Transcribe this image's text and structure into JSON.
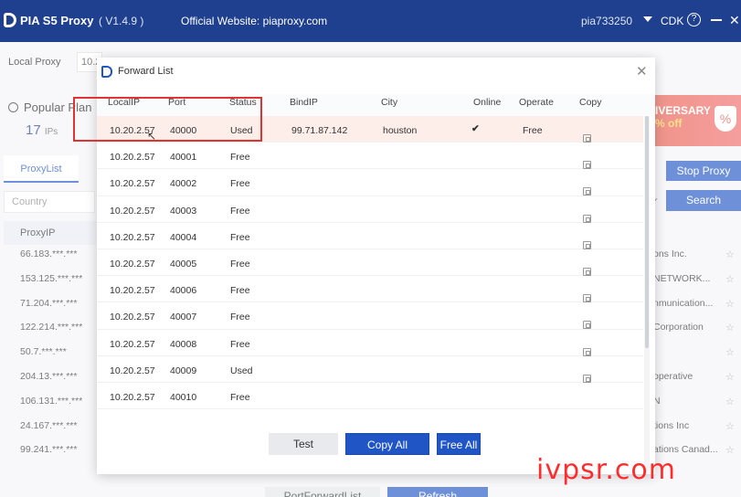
{
  "titlebar": {
    "brand": "PIA S5 Proxy",
    "version": "( V1.4.9 )",
    "website": "Official Website:  piaproxy.com",
    "user": "pia733250",
    "cdk": "CDK",
    "help": "?",
    "close": "✕"
  },
  "background": {
    "local_proxy_label": "Local Proxy",
    "local_proxy_value": "10.2",
    "popular_plan": "Popular Plan",
    "ips_count": "17",
    "ips_unit": "IPs",
    "tab_proxylist": "ProxyList",
    "country_placeholder": "Country",
    "proxyip_header": "ProxyIP",
    "proxy_ips": [
      "66.183.***.***",
      "153.125.***.***",
      "71.204.***.***",
      "122.214.***.***",
      "50.7.***.***",
      "204.13.***.***",
      "106.131.***.***",
      "24.167.***.***",
      "99.241.***.***"
    ],
    "banner_text": "IVERSARY",
    "banner_off": "% off",
    "stop_proxy": "Stop Proxy",
    "search": "Search",
    "isp_fragments": [
      "ons Inc.",
      "NETWORK...",
      "nmunication...",
      "Corporation",
      "",
      "operative",
      "N",
      "tions Inc",
      "ations Canad..."
    ],
    "port_forward_list": "PortForwardList",
    "refresh": "Refresh"
  },
  "dialog": {
    "title": "Forward List",
    "close": "✕",
    "columns": {
      "local_ip": "LocalIP",
      "port": "Port",
      "status": "Status",
      "bind_ip": "BindIP",
      "city": "City",
      "online": "Online",
      "operate": "Operate",
      "copy": "Copy"
    },
    "rows": [
      {
        "local_ip": "10.20.2.57",
        "port": "40000",
        "status": "Used",
        "bind_ip": "99.71.87.142",
        "city": "houston",
        "online": "✔",
        "operate": "Free"
      },
      {
        "local_ip": "10.20.2.57",
        "port": "40001",
        "status": "Free",
        "bind_ip": "",
        "city": "",
        "online": "",
        "operate": ""
      },
      {
        "local_ip": "10.20.2.57",
        "port": "40002",
        "status": "Free",
        "bind_ip": "",
        "city": "",
        "online": "",
        "operate": ""
      },
      {
        "local_ip": "10.20.2.57",
        "port": "40003",
        "status": "Free",
        "bind_ip": "",
        "city": "",
        "online": "",
        "operate": ""
      },
      {
        "local_ip": "10.20.2.57",
        "port": "40004",
        "status": "Free",
        "bind_ip": "",
        "city": "",
        "online": "",
        "operate": ""
      },
      {
        "local_ip": "10.20.2.57",
        "port": "40005",
        "status": "Free",
        "bind_ip": "",
        "city": "",
        "online": "",
        "operate": ""
      },
      {
        "local_ip": "10.20.2.57",
        "port": "40006",
        "status": "Free",
        "bind_ip": "",
        "city": "",
        "online": "",
        "operate": ""
      },
      {
        "local_ip": "10.20.2.57",
        "port": "40007",
        "status": "Free",
        "bind_ip": "",
        "city": "",
        "online": "",
        "operate": ""
      },
      {
        "local_ip": "10.20.2.57",
        "port": "40008",
        "status": "Free",
        "bind_ip": "",
        "city": "",
        "online": "",
        "operate": ""
      },
      {
        "local_ip": "10.20.2.57",
        "port": "40009",
        "status": "Used",
        "bind_ip": "",
        "city": "",
        "online": "",
        "operate": ""
      },
      {
        "local_ip": "10.20.2.57",
        "port": "40010",
        "status": "Free",
        "bind_ip": "",
        "city": "",
        "online": "",
        "operate": ""
      }
    ],
    "buttons": {
      "test": "Test",
      "copy_all": "Copy All",
      "free_all": "Free All"
    }
  },
  "watermark": "ivpsr.com",
  "colors": {
    "titlebar": "#1f3f8f",
    "primary": "#1f55c4",
    "highlight_row": "#fdeee9",
    "annotation": "#e03434",
    "online_check": "#2bb673",
    "operate_free": "#f3a638"
  }
}
